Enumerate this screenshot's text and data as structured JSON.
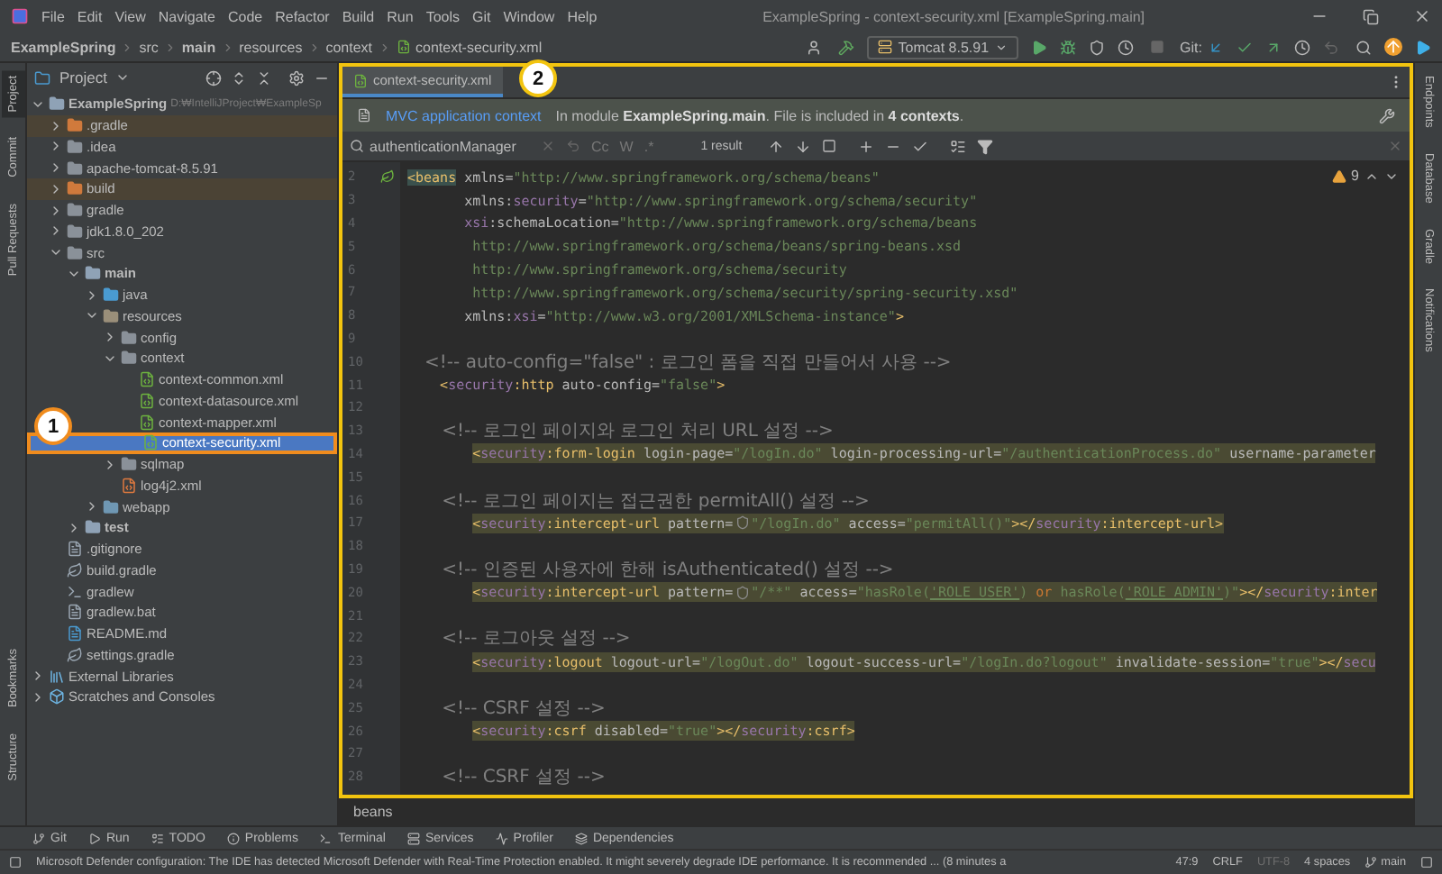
{
  "window": {
    "title": "ExampleSpring - context-security.xml [ExampleSpring.main]"
  },
  "menu": [
    "File",
    "Edit",
    "View",
    "Navigate",
    "Code",
    "Refactor",
    "Build",
    "Run",
    "Tools",
    "Git",
    "Window",
    "Help"
  ],
  "breadcrumb": [
    "ExampleSpring",
    "src",
    "main",
    "resources",
    "context",
    "context-security.xml"
  ],
  "toolbar": {
    "run_config": "Tomcat 8.5.91",
    "vcs_label": "Git:"
  },
  "left_tools": [
    {
      "label": "Project",
      "selected": true
    },
    {
      "label": "Commit",
      "selected": false
    },
    {
      "label": "Pull Requests",
      "selected": false
    }
  ],
  "left_tools_bottom": [
    {
      "label": "Bookmarks"
    },
    {
      "label": "Structure"
    }
  ],
  "right_tools": [
    "Endpoints",
    "Database",
    "Gradle",
    "Notifications"
  ],
  "project": {
    "title": "Project",
    "tree": [
      {
        "label": "ExampleSpring",
        "path": "D:₩IntelliJProject₩ExampleSp",
        "kind": "module",
        "bold": true,
        "expanded": true,
        "children": [
          {
            "label": ".gradle",
            "kind": "excluded",
            "expanded": false,
            "excluded": true
          },
          {
            "label": ".idea",
            "kind": "folder",
            "expanded": false,
            "excluded": false
          },
          {
            "label": "apache-tomcat-8.5.91",
            "kind": "folder",
            "expanded": false,
            "excluded": false
          },
          {
            "label": "build",
            "kind": "excluded",
            "expanded": false,
            "excluded": true
          },
          {
            "label": "gradle",
            "kind": "folder",
            "expanded": false,
            "excluded": false
          },
          {
            "label": "jdk1.8.0_202",
            "kind": "folder",
            "expanded": false,
            "excluded": false
          },
          {
            "label": "src",
            "kind": "folder",
            "expanded": true,
            "children": [
              {
                "label": "main",
                "kind": "module",
                "bold": true,
                "expanded": true,
                "children": [
                  {
                    "label": "java",
                    "kind": "source",
                    "expanded": false
                  },
                  {
                    "label": "resources",
                    "kind": "resources",
                    "expanded": true,
                    "children": [
                      {
                        "label": "config",
                        "kind": "folder",
                        "expanded": false
                      },
                      {
                        "label": "context",
                        "kind": "folder",
                        "expanded": true,
                        "children": [
                          {
                            "label": "context-common.xml",
                            "kind": "spring",
                            "selected": false
                          },
                          {
                            "label": "context-datasource.xml",
                            "kind": "spring",
                            "selected": false
                          },
                          {
                            "label": "context-mapper.xml",
                            "kind": "spring",
                            "selected": false
                          },
                          {
                            "label": "context-security.xml",
                            "kind": "spring",
                            "selected": true,
                            "callout": "1"
                          }
                        ]
                      },
                      {
                        "label": "sqlmap",
                        "kind": "folder",
                        "expanded": false
                      },
                      {
                        "label": "log4j2.xml",
                        "kind": "xml",
                        "selected": false
                      }
                    ]
                  },
                  {
                    "label": "webapp",
                    "kind": "web",
                    "expanded": false
                  }
                ]
              },
              {
                "label": "test",
                "kind": "module",
                "bold": true,
                "expanded": false
              }
            ]
          },
          {
            "label": ".gitignore",
            "kind": "file",
            "selected": false
          },
          {
            "label": "build.gradle",
            "kind": "gradle",
            "selected": false
          },
          {
            "label": "gradlew",
            "kind": "shell",
            "selected": false
          },
          {
            "label": "gradlew.bat",
            "kind": "file",
            "selected": false
          },
          {
            "label": "README.md",
            "kind": "markdown",
            "selected": false
          },
          {
            "label": "settings.gradle",
            "kind": "gradle",
            "selected": false
          }
        ]
      },
      {
        "label": "External Libraries",
        "kind": "libraries",
        "expanded": false
      },
      {
        "label": "Scratches and Consoles",
        "kind": "scratches",
        "expanded": false
      }
    ]
  },
  "editor": {
    "callout": "2",
    "tabs": [
      {
        "label": "context-security.xml",
        "selected": true
      }
    ],
    "info": {
      "link": "MVC application context",
      "text": "In module **ExampleSpring.main**. File is included in **4 contexts**."
    },
    "search": {
      "value": "authenticationManager",
      "options": [
        "Cc",
        "W",
        ".*"
      ],
      "result": "1 result"
    },
    "warnings": "9",
    "lines": [
      {
        "num": "2",
        "highlight": false,
        "bean_marker": true,
        "tokens": [
          {
            "kind": "tagm",
            "text": "<beans"
          },
          {
            "kind": "attr",
            "text": " xmlns"
          },
          {
            "kind": "eq",
            "text": "="
          },
          {
            "kind": "value",
            "text": "\"http://www.springframework.org/schema/beans\""
          }
        ]
      },
      {
        "num": "3",
        "highlight": false,
        "tokens": [
          {
            "kind": "attr",
            "text": "       xmlns:"
          },
          {
            "kind": "ns",
            "text": "security"
          },
          {
            "kind": "eq",
            "text": "="
          },
          {
            "kind": "value",
            "text": "\"http://www.springframework.org/schema/security\""
          }
        ]
      },
      {
        "num": "4",
        "highlight": false,
        "tokens": [
          {
            "kind": "ns",
            "text": "       xsi"
          },
          {
            "kind": "attr",
            "text": ":schemaLocation"
          },
          {
            "kind": "eq",
            "text": "="
          },
          {
            "kind": "value",
            "text": "\"http://www.springframework.org/schema/beans"
          }
        ]
      },
      {
        "num": "5",
        "highlight": false,
        "tokens": [
          {
            "kind": "value",
            "text": "        http://www.springframework.org/schema/beans/spring-beans.xsd"
          }
        ]
      },
      {
        "num": "6",
        "highlight": false,
        "tokens": [
          {
            "kind": "value",
            "text": "        http://www.springframework.org/schema/security"
          }
        ]
      },
      {
        "num": "7",
        "highlight": false,
        "tokens": [
          {
            "kind": "value",
            "text": "        http://www.springframework.org/schema/security/spring-security.xsd\""
          }
        ]
      },
      {
        "num": "8",
        "highlight": false,
        "tokens": [
          {
            "kind": "attr",
            "text": "       xmlns:"
          },
          {
            "kind": "ns",
            "text": "xsi"
          },
          {
            "kind": "eq",
            "text": "="
          },
          {
            "kind": "value",
            "text": "\"http://www.w3.org/2001/XMLSchema-instance\""
          },
          {
            "kind": "tag",
            "text": ">"
          }
        ]
      },
      {
        "num": "9",
        "highlight": false
      },
      {
        "num": "10",
        "highlight": false,
        "tokens": [
          {
            "kind": "comment",
            "text": "   <!-- auto-config=\"false\" : 로그인 폼을 직접 만들어서 사용 -->"
          }
        ]
      },
      {
        "num": "11",
        "highlight": false,
        "tokens": [
          {
            "kind": "tag",
            "text": "    <"
          },
          {
            "kind": "ns",
            "text": "security"
          },
          {
            "kind": "tag",
            "text": ":http"
          },
          {
            "kind": "attr",
            "text": " auto-config"
          },
          {
            "kind": "eq",
            "text": "="
          },
          {
            "kind": "value",
            "text": "\"false\""
          },
          {
            "kind": "tag",
            "text": ">"
          }
        ]
      },
      {
        "num": "12",
        "highlight": false
      },
      {
        "num": "13",
        "highlight": false,
        "tokens": [
          {
            "kind": "comment",
            "text": "      <!-- 로그인 페이지와 로그인 처리 URL 설정 -->"
          }
        ]
      },
      {
        "num": "14",
        "highlight": true,
        "tokens": [
          {
            "kind": "tag",
            "text": "<"
          },
          {
            "kind": "ns",
            "text": "security"
          },
          {
            "kind": "tag",
            "text": ":form-login"
          },
          {
            "kind": "attr",
            "text": " login-page"
          },
          {
            "kind": "eq",
            "text": "="
          },
          {
            "kind": "value",
            "text": "\"/logIn.do\""
          },
          {
            "kind": "attr",
            "text": " login-processing-url"
          },
          {
            "kind": "eq",
            "text": "="
          },
          {
            "kind": "value",
            "text": "\"/authenticationProcess.do\""
          },
          {
            "kind": "attr",
            "text": " username-parameter"
          }
        ]
      },
      {
        "num": "15",
        "highlight": false
      },
      {
        "num": "16",
        "highlight": false,
        "tokens": [
          {
            "kind": "comment",
            "text": "      <!-- 로그인 페이지는 접근권한 permitAll() 설정 -->"
          }
        ]
      },
      {
        "num": "17",
        "highlight": true,
        "tokens": [
          {
            "kind": "tag",
            "text": "<"
          },
          {
            "kind": "ns",
            "text": "security"
          },
          {
            "kind": "tag",
            "text": ":intercept-url"
          },
          {
            "kind": "attr",
            "text": " pattern"
          },
          {
            "kind": "eq",
            "text": "="
          },
          {
            "kind": "shield"
          },
          {
            "kind": "value",
            "text": "\"/logIn.do\""
          },
          {
            "kind": "attr",
            "text": " access"
          },
          {
            "kind": "eq",
            "text": "="
          },
          {
            "kind": "value",
            "text": "\"permitAll()\""
          },
          {
            "kind": "tag",
            "text": "></"
          },
          {
            "kind": "ns",
            "text": "security"
          },
          {
            "kind": "tag",
            "text": ":intercept-url>"
          }
        ]
      },
      {
        "num": "18",
        "highlight": false
      },
      {
        "num": "19",
        "highlight": false,
        "tokens": [
          {
            "kind": "comment",
            "text": "      <!-- 인증된 사용자에 한해 isAuthenticated() 설정 -->"
          }
        ]
      },
      {
        "num": "20",
        "highlight": true,
        "tokens": [
          {
            "kind": "tag",
            "text": "<"
          },
          {
            "kind": "ns",
            "text": "security"
          },
          {
            "kind": "tag",
            "text": ":intercept-url"
          },
          {
            "kind": "attr",
            "text": " pattern"
          },
          {
            "kind": "eq",
            "text": "="
          },
          {
            "kind": "shield"
          },
          {
            "kind": "value",
            "text": "\"/**\""
          },
          {
            "kind": "attr",
            "text": " access"
          },
          {
            "kind": "eq",
            "text": "="
          },
          {
            "kind": "value",
            "text": "\"hasRole("
          },
          {
            "kind": "under",
            "text": "'ROLE_USER'"
          },
          {
            "kind": "value",
            "text": ") "
          },
          {
            "kind": "keyword",
            "text": "or"
          },
          {
            "kind": "value",
            "text": " hasRole("
          },
          {
            "kind": "under",
            "text": "'ROLE_ADMIN'"
          },
          {
            "kind": "value",
            "text": ")\""
          },
          {
            "kind": "tag",
            "text": "></"
          },
          {
            "kind": "ns",
            "text": "security"
          },
          {
            "kind": "tag",
            "text": ":inter"
          }
        ]
      },
      {
        "num": "21",
        "highlight": false
      },
      {
        "num": "22",
        "highlight": false,
        "tokens": [
          {
            "kind": "comment",
            "text": "      <!-- 로그아웃 설정 -->"
          }
        ]
      },
      {
        "num": "23",
        "highlight": true,
        "tokens": [
          {
            "kind": "tag",
            "text": "<"
          },
          {
            "kind": "ns",
            "text": "security"
          },
          {
            "kind": "tag",
            "text": ":logout"
          },
          {
            "kind": "attr",
            "text": " logout-url"
          },
          {
            "kind": "eq",
            "text": "="
          },
          {
            "kind": "value",
            "text": "\"/logOut.do\""
          },
          {
            "kind": "attr",
            "text": " logout-success-url"
          },
          {
            "kind": "eq",
            "text": "="
          },
          {
            "kind": "value",
            "text": "\"/logIn.do?logout\""
          },
          {
            "kind": "attr",
            "text": " invalidate-session"
          },
          {
            "kind": "eq",
            "text": "="
          },
          {
            "kind": "value",
            "text": "\"true\""
          },
          {
            "kind": "tag",
            "text": "></"
          },
          {
            "kind": "ns",
            "text": "secu"
          }
        ]
      },
      {
        "num": "24",
        "highlight": false
      },
      {
        "num": "25",
        "highlight": false,
        "tokens": [
          {
            "kind": "comment",
            "text": "      <!-- CSRF 설정 -->"
          }
        ]
      },
      {
        "num": "26",
        "highlight": true,
        "tokens": [
          {
            "kind": "tag",
            "text": "<"
          },
          {
            "kind": "ns",
            "text": "security"
          },
          {
            "kind": "tag",
            "text": ":csrf"
          },
          {
            "kind": "attr",
            "text": " disabled"
          },
          {
            "kind": "eq",
            "text": "="
          },
          {
            "kind": "value",
            "text": "\"true\""
          },
          {
            "kind": "tag",
            "text": "></"
          },
          {
            "kind": "ns",
            "text": "security"
          },
          {
            "kind": "tag",
            "text": ":csrf>"
          }
        ]
      },
      {
        "num": "27",
        "highlight": false
      },
      {
        "num": "28",
        "highlight": false,
        "tokens": [
          {
            "kind": "comment",
            "text": "      <!-- CSRF 설정 -->"
          }
        ]
      }
    ],
    "breadcrumb": "beans"
  },
  "tool_windows": [
    {
      "label": "Git",
      "kind": "git"
    },
    {
      "label": "Run",
      "kind": "run"
    },
    {
      "label": "TODO",
      "kind": "todo"
    },
    {
      "label": "Problems",
      "kind": "problems"
    },
    {
      "label": "Terminal",
      "kind": "terminal"
    },
    {
      "label": "Services",
      "kind": "services"
    },
    {
      "label": "Profiler",
      "kind": "profiler"
    },
    {
      "label": "Dependencies",
      "kind": "deps"
    }
  ],
  "status_bar": {
    "message": "Microsoft Defender configuration: The IDE has detected Microsoft Defender with Real-Time Protection enabled. It might severely degrade IDE performance. It is recommended ... (8 minutes a",
    "position": "47:9",
    "line_ending": "CRLF",
    "encoding": "UTF-8",
    "indent": "4 spaces",
    "branch": "main"
  }
}
